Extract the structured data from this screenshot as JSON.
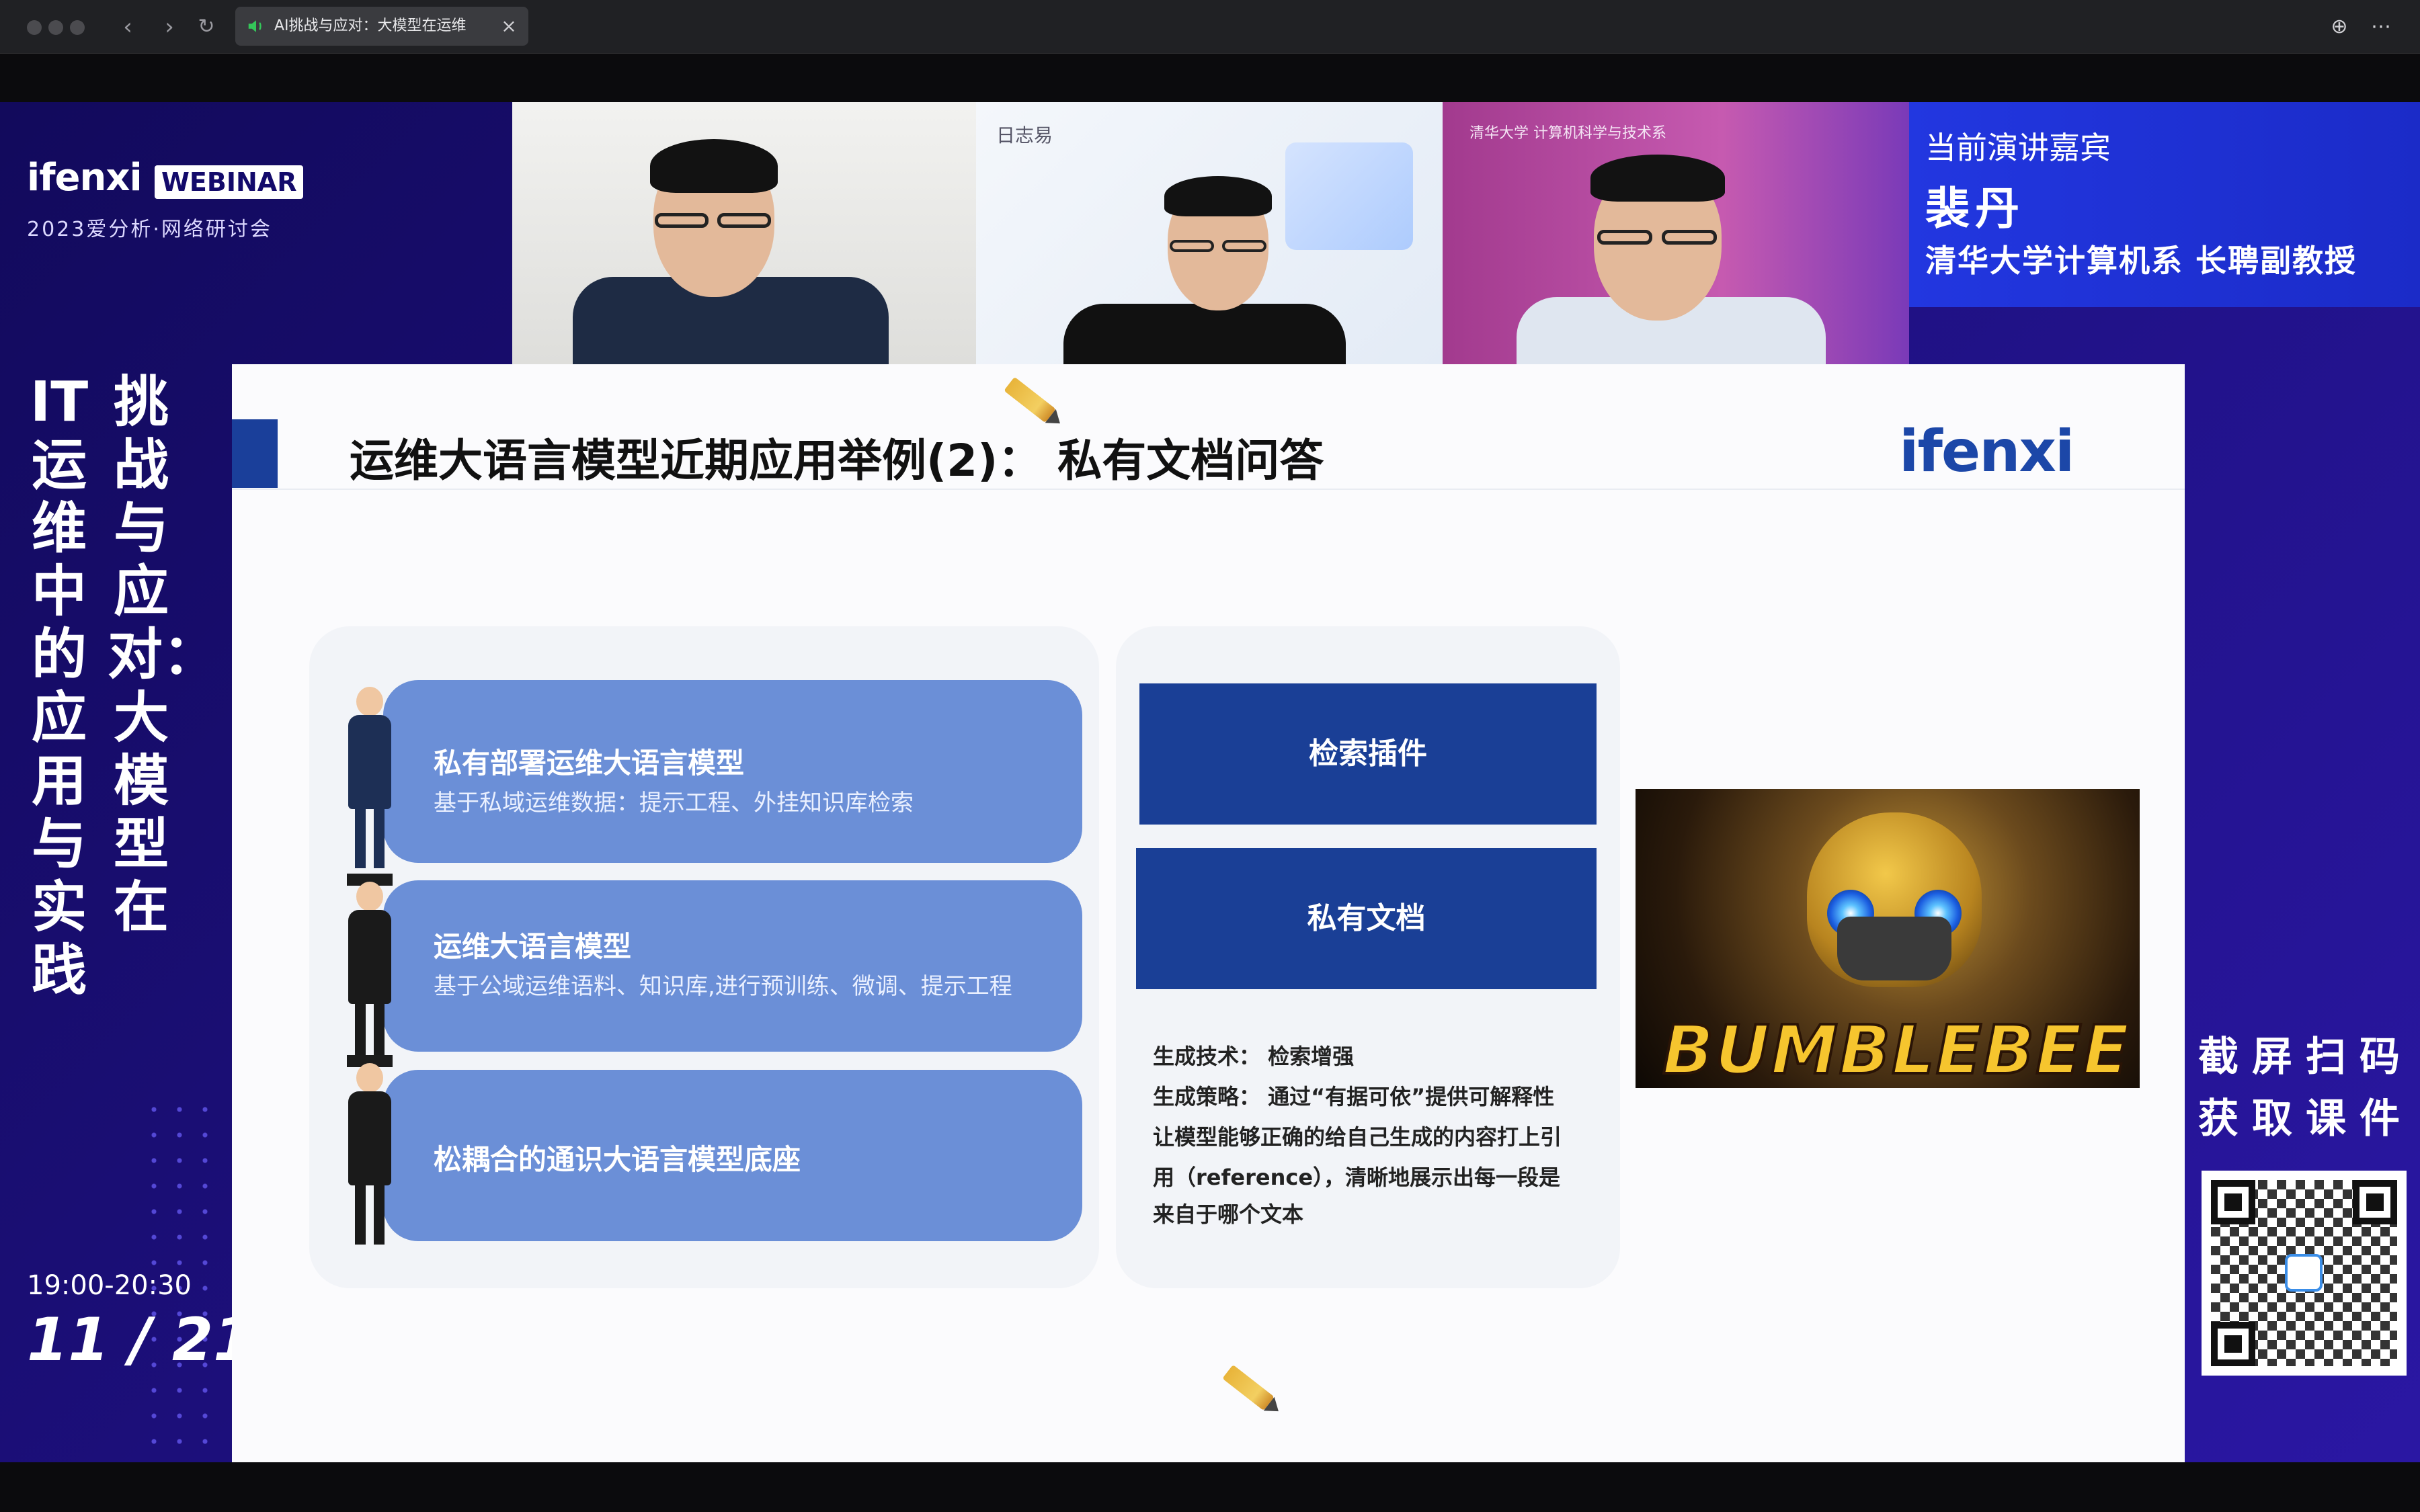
{
  "browser": {
    "tab_title": "AI挑战与应对：大模型在运维",
    "icons": [
      "speaker-icon",
      "close-icon",
      "back-icon",
      "forward-icon",
      "reload-icon",
      "globe-icon",
      "more-icon"
    ]
  },
  "brand": {
    "logo": "ifenxi",
    "badge": "WEBINAR",
    "subtitle": "2023爱分析·网络研讨会"
  },
  "event": {
    "title_col1": "IT运维中的应用与实践",
    "title_col2": "挑战与应对：大模型在",
    "time": "19:00-20:30",
    "date": "11 / 21"
  },
  "speaker": {
    "label": "当前演讲嘉宾",
    "name": "裴丹",
    "title": "清华大学计算机系 长聘副教授"
  },
  "videos": [
    {
      "name": "video-participant-1",
      "watermark": ""
    },
    {
      "name": "video-participant-2",
      "watermark": "日志易"
    },
    {
      "name": "video-participant-3",
      "watermark": "清华大学 计算机科学与技术系"
    }
  ],
  "slide": {
    "title": "运维大语言模型近期应用举例(2)：  私有文档问答",
    "logo": "ifenxi",
    "cards": [
      {
        "title": "私有部署运维大语言模型",
        "subtitle": "基于私域运维数据：提示工程、外挂知识库检索"
      },
      {
        "title": "运维大语言模型",
        "subtitle": "基于公域运维语料、知识库,进行预训练、微调、提示工程"
      },
      {
        "title": "松耦合的通识大语言模型底座",
        "subtitle": ""
      }
    ],
    "box1": "检索插件",
    "box2": "私有文档",
    "notes": [
      "生成技术：  检索增强",
      "生成策略：  通过“有据可依”提供可解释性",
      "让模型能够正确的给自己生成的内容打上引",
      "用（reference），清晰地展示出每一段是",
      "来自于哪个文本"
    ],
    "poster_title": "BUMBLEBEE"
  },
  "cta": {
    "line1": "截屏扫码",
    "line2": "获取课件"
  },
  "colors": {
    "stage_bg": "#1c0f7a",
    "speaker_panel": "#1f33d8",
    "card_blue": "#6b8fd7",
    "box_blue": "#1a3f96",
    "slide_accent": "#1a3f9a"
  }
}
